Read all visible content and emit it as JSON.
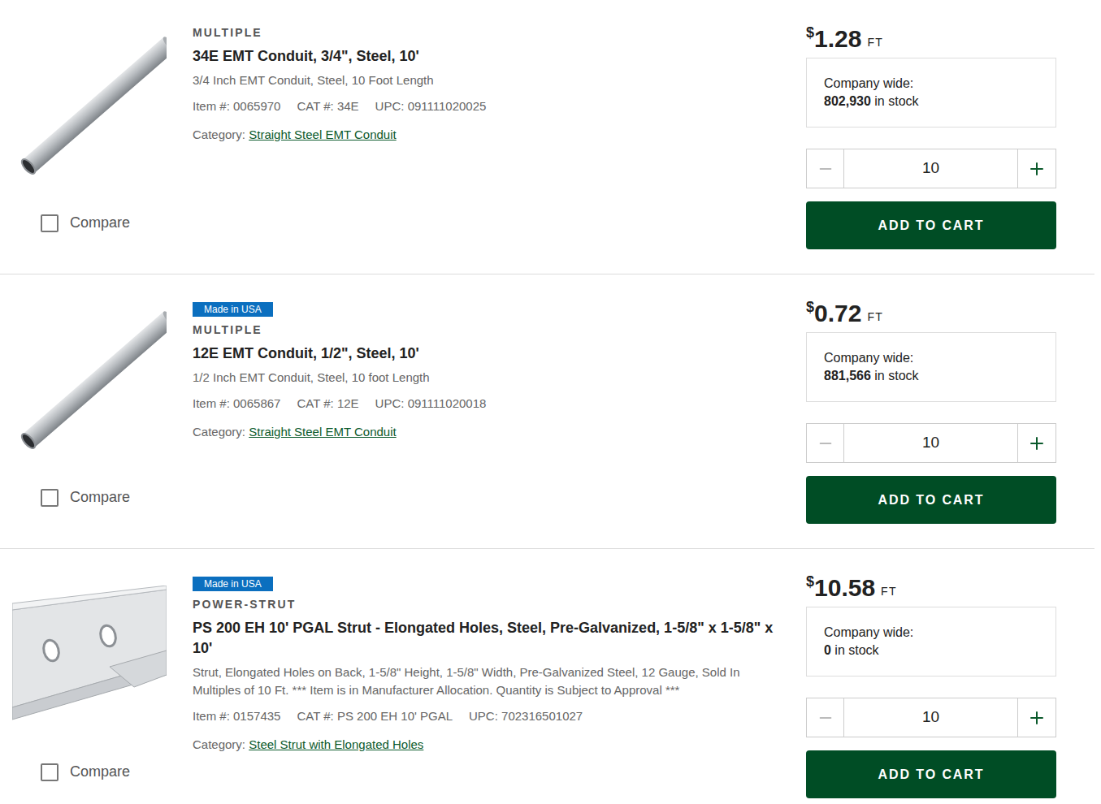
{
  "products": [
    {
      "kind": "conduit",
      "brand": "MULTIPLE",
      "title": "34E EMT Conduit, 3/4\", Steel, 10'",
      "description": "3/4 Inch EMT Conduit, Steel, 10 Foot Length",
      "item_label": "Item #:",
      "item": "0065970",
      "cat_label": "CAT #:",
      "cat": "34E",
      "upc_label": "UPC:",
      "upc": "091111020025",
      "category_label": "Category:",
      "category": "Straight Steel EMT Conduit",
      "currency": "$",
      "price": "1.28",
      "unit": "FT",
      "stock_label": "Company wide:",
      "stock_count": "802,930",
      "stock_suffix": "in stock",
      "quantity": "10",
      "minus_disabled": true,
      "button": "ADD TO CART",
      "compare_label": "Compare",
      "compare_checked": false
    },
    {
      "kind": "conduit",
      "badge": "Made in USA",
      "brand": "MULTIPLE",
      "title": "12E EMT Conduit, 1/2\", Steel, 10'",
      "description": "1/2 Inch EMT Conduit, Steel, 10 foot Length",
      "item_label": "Item #:",
      "item": "0065867",
      "cat_label": "CAT #:",
      "cat": "12E",
      "upc_label": "UPC:",
      "upc": "091111020018",
      "category_label": "Category:",
      "category": "Straight Steel EMT Conduit",
      "currency": "$",
      "price": "0.72",
      "unit": "FT",
      "stock_label": "Company wide:",
      "stock_count": "881,566",
      "stock_suffix": "in stock",
      "quantity": "10",
      "minus_disabled": true,
      "button": "ADD TO CART",
      "compare_label": "Compare",
      "compare_checked": false
    },
    {
      "kind": "strut",
      "badge": "Made in USA",
      "brand": "POWER-STRUT",
      "title": "PS 200 EH 10' PGAL Strut - Elongated Holes, Steel, Pre-Galvanized, 1-5/8\" x 1-5/8\" x 10'",
      "description": "Strut, Elongated Holes on Back, 1-5/8\" Height, 1-5/8\" Width, Pre-Galvanized Steel, 12 Gauge, Sold In Multiples of 10 Ft. *** Item is in Manufacturer Allocation. Quantity is Subject to Approval ***",
      "item_label": "Item #:",
      "item": "0157435",
      "cat_label": "CAT #:",
      "cat": "PS 200 EH 10' PGAL",
      "upc_label": "UPC:",
      "upc": "702316501027",
      "category_label": "Category:",
      "category": "Steel Strut with Elongated Holes",
      "currency": "$",
      "price": "10.58",
      "unit": "FT",
      "stock_label": "Company wide:",
      "stock_count": "0",
      "stock_suffix": "in stock",
      "quantity": "10",
      "minus_disabled": true,
      "button": "ADD TO CART",
      "compare_label": "Compare",
      "compare_checked": false
    }
  ]
}
